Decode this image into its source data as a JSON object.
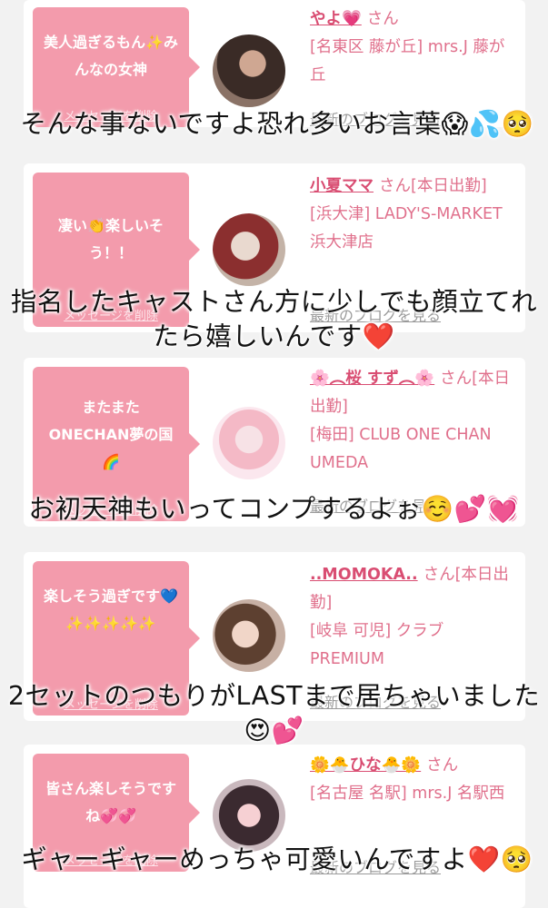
{
  "cards": [
    {
      "message": "美人過ぎるもん✨みんなの女神",
      "delete_label": "メッセージを削除",
      "name": "やよ💗",
      "san": "さん",
      "status": "",
      "shop": "[名東区 藤が丘] mrs.J 藤が丘",
      "blog_label": "最新のブログを見る",
      "avatar_icon": "user-photo",
      "caption": "そんな事ないですよ恐れ多いお言葉😱💦🥺"
    },
    {
      "message": "凄い👏楽しいそう！！",
      "delete_label": "メッセージを削除",
      "name": "小夏ママ",
      "san": "さん",
      "status": "[本日出勤]",
      "shop": "[浜大津] LADY'S-MARKET 浜大津店",
      "blog_label": "最新のブログを見る",
      "avatar_icon": "user-photo",
      "caption": "指名したキャストさん方に少しでも顔立てれたら嬉しいんです❤️"
    },
    {
      "message": "またまたONECHAN夢の国🌈",
      "delete_label": "メッセージを削除",
      "name": "🌸︵桜 すず︵🌸",
      "san": "さん",
      "status": "[本日出勤]",
      "shop": "[梅田] CLUB ONE CHAN UMEDA",
      "blog_label": "最新のブログを見る",
      "avatar_icon": "user-photo",
      "caption": "お初天神もいってコンプするよぉ☺️💕💓"
    },
    {
      "message": "楽しそう過ぎです💙✨✨✨✨✨",
      "delete_label": "メッセージを削除",
      "name": "..MOMOKA..",
      "san": "さん",
      "status": "[本日出勤]",
      "shop": "[岐阜 可児] クラブ PREMIUM",
      "blog_label": "最新のブログを見る",
      "avatar_icon": "user-photo",
      "caption": "2セットのつもりがLASTまで居ちゃいました😍💕"
    },
    {
      "message": "皆さん楽しそうですね💞💞",
      "delete_label": "メッセージを削除",
      "name": "🌼🐣ひな🐣🌼",
      "san": "さん",
      "status": "",
      "shop": "[名古屋 名駅] mrs.J 名駅西",
      "blog_label": "最新のブログを見る",
      "avatar_icon": "user-photo",
      "caption": "ギャーギャーめっちゃ可愛いんですよ❤️🥺"
    }
  ],
  "colors": {
    "bubble": "#f39bac",
    "name": "#d94d72",
    "info": "#e0708c",
    "page_bg": "#f2f2f2"
  }
}
